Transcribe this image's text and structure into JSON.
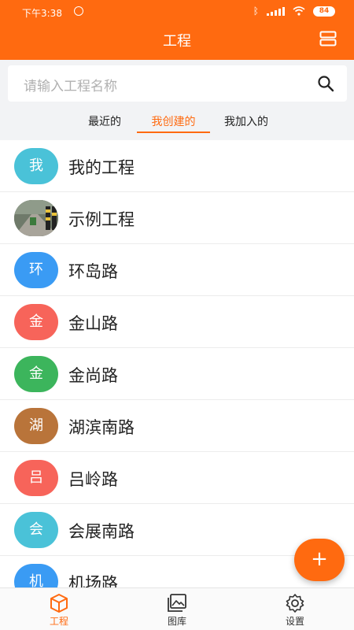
{
  "status_bar": {
    "time": "下午3:38",
    "battery": "84"
  },
  "header": {
    "title": "工程"
  },
  "search": {
    "placeholder": "请输入工程名称"
  },
  "tabs": [
    {
      "label": "最近的",
      "active": false
    },
    {
      "label": "我创建的",
      "active": true
    },
    {
      "label": "我加入的",
      "active": false
    }
  ],
  "projects": [
    {
      "avatar": "我",
      "name": "我的工程",
      "color": "#4ac2d8"
    },
    {
      "avatar": "",
      "name": "示例工程",
      "color": "#5a6a5a"
    },
    {
      "avatar": "环",
      "name": "环岛路",
      "color": "#3a9bf4"
    },
    {
      "avatar": "金",
      "name": "金山路",
      "color": "#f7645a"
    },
    {
      "avatar": "金",
      "name": "金尚路",
      "color": "#3cb55c"
    },
    {
      "avatar": "湖",
      "name": "湖滨南路",
      "color": "#b9743a"
    },
    {
      "avatar": "吕",
      "name": "吕岭路",
      "color": "#f7645a"
    },
    {
      "avatar": "会",
      "name": "会展南路",
      "color": "#4ac2d8"
    },
    {
      "avatar": "机",
      "name": "机场路",
      "color": "#3a9bf4"
    }
  ],
  "fab": {
    "label": "+"
  },
  "bottom_nav": [
    {
      "label": "工程",
      "icon": "cube-icon",
      "active": true
    },
    {
      "label": "图库",
      "icon": "gallery-icon",
      "active": false
    },
    {
      "label": "设置",
      "icon": "gear-icon",
      "active": false
    }
  ],
  "colors": {
    "brand": "#ff6a10"
  }
}
